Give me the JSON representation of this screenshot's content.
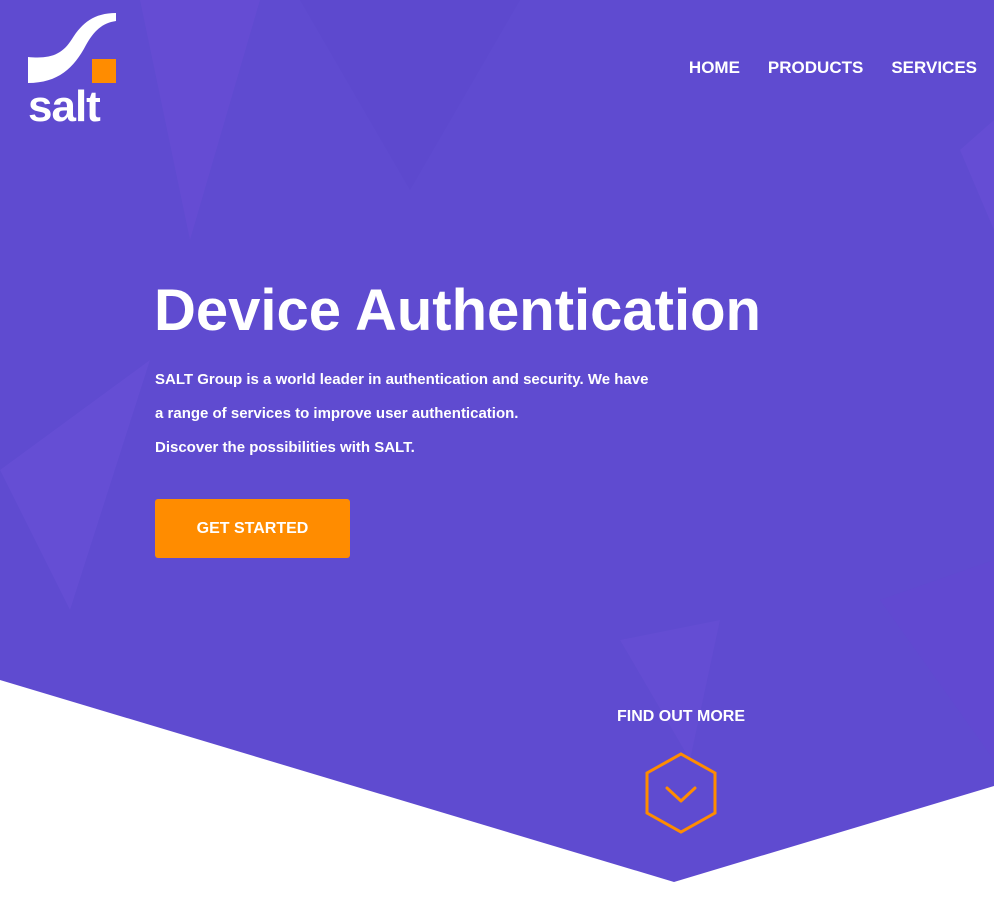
{
  "brand": {
    "logo_text": "salt",
    "accent_color": "#ff8c00",
    "hero_color": "#5f4bd0"
  },
  "nav": {
    "items": [
      {
        "label": "HOME"
      },
      {
        "label": "PRODUCTS"
      },
      {
        "label": "SERVICES"
      }
    ]
  },
  "hero": {
    "title": "Device Authentication",
    "description_lines": [
      "SALT Group is a world leader in authentication and security. We have",
      "a range of services to improve user authentication.",
      "Discover the possibilities with SALT."
    ],
    "cta_label": "GET STARTED",
    "find_more_label": "FIND OUT MORE",
    "scroll_icon": "chevron-down-icon"
  }
}
